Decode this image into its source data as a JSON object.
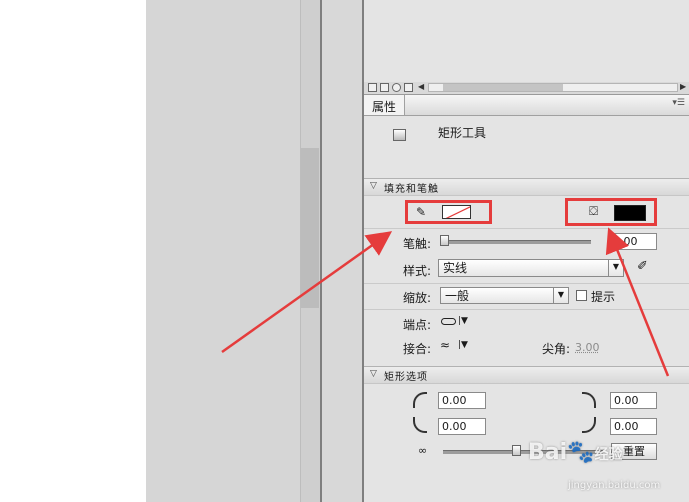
{
  "properties_panel": {
    "tab_label": "属性",
    "panel_menu_glyph": "▾☰",
    "tool_name": "矩形工具",
    "fill_stroke_section": "填充和笔触",
    "stroke_label": "笔触:",
    "stroke_value": "3.00",
    "style_label": "样式:",
    "style_value": "实线",
    "scale_label": "缩放:",
    "scale_value": "一般",
    "hint_label": "提示",
    "cap_label": "端点:",
    "join_label": "接合:",
    "miter_label": "尖角:",
    "miter_value": "3.00",
    "rect_options_section": "矩形选项",
    "corner_tl": "0.00",
    "corner_tr": "0.00",
    "corner_bl": "0.00",
    "corner_br": "0.00",
    "reset_label": "重置",
    "fill_color": "#000000",
    "highlight_color": "#e53c3c"
  },
  "watermark": {
    "brand": "Bai",
    "brand_tail": "经验",
    "url": "jingyan.baidu.com"
  }
}
